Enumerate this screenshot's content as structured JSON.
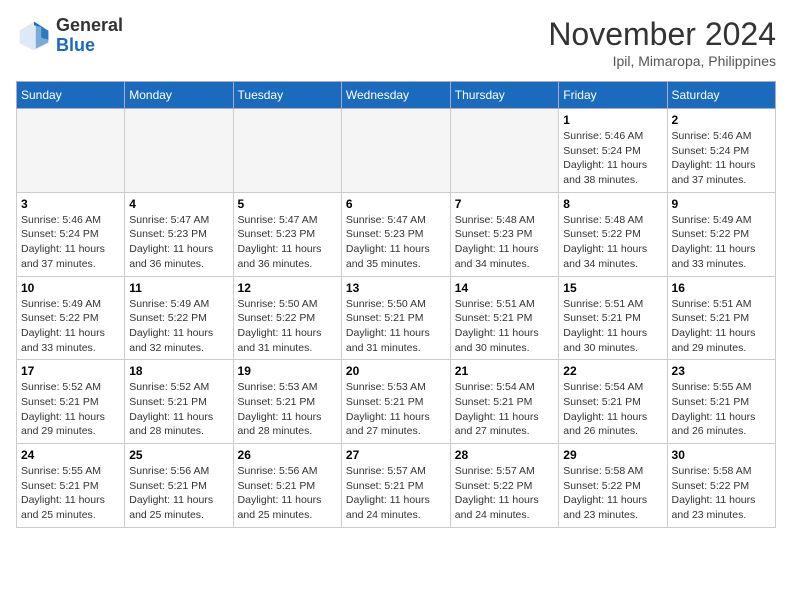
{
  "header": {
    "logo_general": "General",
    "logo_blue": "Blue",
    "month_title": "November 2024",
    "location": "Ipil, Mimaropa, Philippines"
  },
  "calendar": {
    "weekdays": [
      "Sunday",
      "Monday",
      "Tuesday",
      "Wednesday",
      "Thursday",
      "Friday",
      "Saturday"
    ],
    "weeks": [
      [
        {
          "day": "",
          "info": ""
        },
        {
          "day": "",
          "info": ""
        },
        {
          "day": "",
          "info": ""
        },
        {
          "day": "",
          "info": ""
        },
        {
          "day": "",
          "info": ""
        },
        {
          "day": "1",
          "info": "Sunrise: 5:46 AM\nSunset: 5:24 PM\nDaylight: 11 hours\nand 38 minutes."
        },
        {
          "day": "2",
          "info": "Sunrise: 5:46 AM\nSunset: 5:24 PM\nDaylight: 11 hours\nand 37 minutes."
        }
      ],
      [
        {
          "day": "3",
          "info": "Sunrise: 5:46 AM\nSunset: 5:24 PM\nDaylight: 11 hours\nand 37 minutes."
        },
        {
          "day": "4",
          "info": "Sunrise: 5:47 AM\nSunset: 5:23 PM\nDaylight: 11 hours\nand 36 minutes."
        },
        {
          "day": "5",
          "info": "Sunrise: 5:47 AM\nSunset: 5:23 PM\nDaylight: 11 hours\nand 36 minutes."
        },
        {
          "day": "6",
          "info": "Sunrise: 5:47 AM\nSunset: 5:23 PM\nDaylight: 11 hours\nand 35 minutes."
        },
        {
          "day": "7",
          "info": "Sunrise: 5:48 AM\nSunset: 5:23 PM\nDaylight: 11 hours\nand 34 minutes."
        },
        {
          "day": "8",
          "info": "Sunrise: 5:48 AM\nSunset: 5:22 PM\nDaylight: 11 hours\nand 34 minutes."
        },
        {
          "day": "9",
          "info": "Sunrise: 5:49 AM\nSunset: 5:22 PM\nDaylight: 11 hours\nand 33 minutes."
        }
      ],
      [
        {
          "day": "10",
          "info": "Sunrise: 5:49 AM\nSunset: 5:22 PM\nDaylight: 11 hours\nand 33 minutes."
        },
        {
          "day": "11",
          "info": "Sunrise: 5:49 AM\nSunset: 5:22 PM\nDaylight: 11 hours\nand 32 minutes."
        },
        {
          "day": "12",
          "info": "Sunrise: 5:50 AM\nSunset: 5:22 PM\nDaylight: 11 hours\nand 31 minutes."
        },
        {
          "day": "13",
          "info": "Sunrise: 5:50 AM\nSunset: 5:21 PM\nDaylight: 11 hours\nand 31 minutes."
        },
        {
          "day": "14",
          "info": "Sunrise: 5:51 AM\nSunset: 5:21 PM\nDaylight: 11 hours\nand 30 minutes."
        },
        {
          "day": "15",
          "info": "Sunrise: 5:51 AM\nSunset: 5:21 PM\nDaylight: 11 hours\nand 30 minutes."
        },
        {
          "day": "16",
          "info": "Sunrise: 5:51 AM\nSunset: 5:21 PM\nDaylight: 11 hours\nand 29 minutes."
        }
      ],
      [
        {
          "day": "17",
          "info": "Sunrise: 5:52 AM\nSunset: 5:21 PM\nDaylight: 11 hours\nand 29 minutes."
        },
        {
          "day": "18",
          "info": "Sunrise: 5:52 AM\nSunset: 5:21 PM\nDaylight: 11 hours\nand 28 minutes."
        },
        {
          "day": "19",
          "info": "Sunrise: 5:53 AM\nSunset: 5:21 PM\nDaylight: 11 hours\nand 28 minutes."
        },
        {
          "day": "20",
          "info": "Sunrise: 5:53 AM\nSunset: 5:21 PM\nDaylight: 11 hours\nand 27 minutes."
        },
        {
          "day": "21",
          "info": "Sunrise: 5:54 AM\nSunset: 5:21 PM\nDaylight: 11 hours\nand 27 minutes."
        },
        {
          "day": "22",
          "info": "Sunrise: 5:54 AM\nSunset: 5:21 PM\nDaylight: 11 hours\nand 26 minutes."
        },
        {
          "day": "23",
          "info": "Sunrise: 5:55 AM\nSunset: 5:21 PM\nDaylight: 11 hours\nand 26 minutes."
        }
      ],
      [
        {
          "day": "24",
          "info": "Sunrise: 5:55 AM\nSunset: 5:21 PM\nDaylight: 11 hours\nand 25 minutes."
        },
        {
          "day": "25",
          "info": "Sunrise: 5:56 AM\nSunset: 5:21 PM\nDaylight: 11 hours\nand 25 minutes."
        },
        {
          "day": "26",
          "info": "Sunrise: 5:56 AM\nSunset: 5:21 PM\nDaylight: 11 hours\nand 25 minutes."
        },
        {
          "day": "27",
          "info": "Sunrise: 5:57 AM\nSunset: 5:21 PM\nDaylight: 11 hours\nand 24 minutes."
        },
        {
          "day": "28",
          "info": "Sunrise: 5:57 AM\nSunset: 5:22 PM\nDaylight: 11 hours\nand 24 minutes."
        },
        {
          "day": "29",
          "info": "Sunrise: 5:58 AM\nSunset: 5:22 PM\nDaylight: 11 hours\nand 23 minutes."
        },
        {
          "day": "30",
          "info": "Sunrise: 5:58 AM\nSunset: 5:22 PM\nDaylight: 11 hours\nand 23 minutes."
        }
      ]
    ]
  }
}
